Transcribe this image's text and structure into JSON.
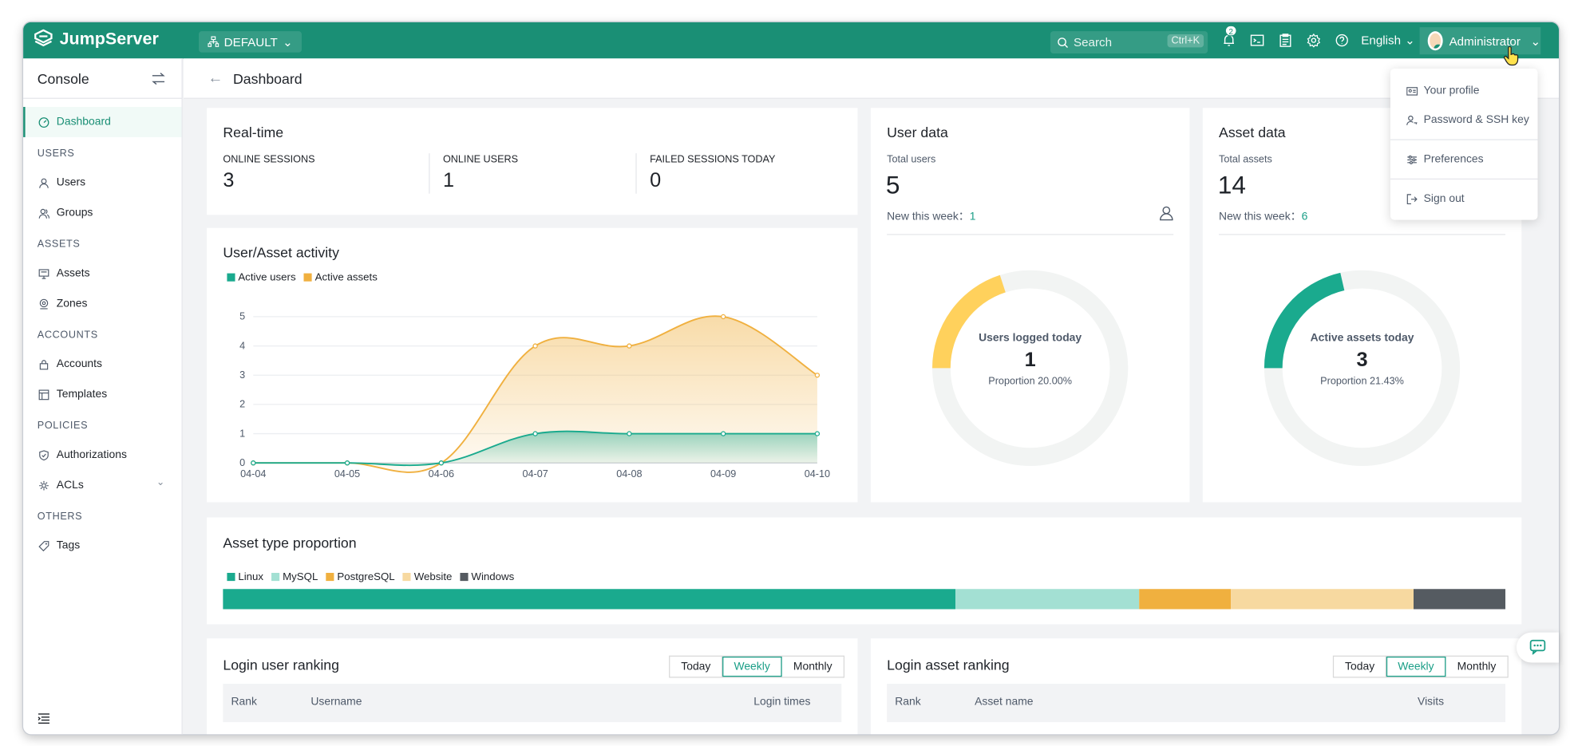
{
  "app": {
    "name": "JumpServer",
    "org": "DEFAULT"
  },
  "topbar": {
    "search_placeholder": "Search",
    "search_shortcut": "Ctrl+K",
    "notifications_count": "2",
    "language": "English",
    "user_name": "Administrator"
  },
  "sidebar": {
    "title": "Console",
    "dashboard": "Dashboard",
    "groups": [
      {
        "label": "USERS",
        "items": [
          "Users",
          "Groups"
        ]
      },
      {
        "label": "ASSETS",
        "items": [
          "Assets",
          "Zones"
        ]
      },
      {
        "label": "ACCOUNTS",
        "items": [
          "Accounts",
          "Templates"
        ]
      },
      {
        "label": "POLICIES",
        "items": [
          "Authorizations",
          "ACLs"
        ]
      },
      {
        "label": "OTHERS",
        "items": [
          "Tags"
        ]
      }
    ]
  },
  "page": {
    "title": "Dashboard"
  },
  "realtime": {
    "title": "Real-time",
    "online_sessions_label": "ONLINE SESSIONS",
    "online_sessions": "3",
    "online_users_label": "ONLINE USERS",
    "online_users": "1",
    "failed_sessions_label": "FAILED SESSIONS TODAY",
    "failed_sessions": "0"
  },
  "activity": {
    "title": "User/Asset activity",
    "legend_users": "Active users",
    "legend_assets": "Active assets",
    "color_users": "#1aaa8e",
    "color_assets": "#f0b03f"
  },
  "chart_data": {
    "type": "area",
    "title": "User/Asset activity",
    "x": [
      "04-04",
      "04-05",
      "04-06",
      "04-07",
      "04-08",
      "04-09",
      "04-10"
    ],
    "series": [
      {
        "name": "Active users",
        "values": [
          0,
          0,
          0,
          1,
          1,
          1,
          1
        ]
      },
      {
        "name": "Active assets",
        "values": [
          0,
          0,
          0,
          4,
          4,
          5,
          3
        ]
      }
    ],
    "yticks": [
      "0",
      "1",
      "2",
      "3",
      "4",
      "5"
    ],
    "ylim": [
      0,
      5
    ],
    "legend": "top-left",
    "grid": true
  },
  "user_data": {
    "title": "User data",
    "total_label": "Total users",
    "total": "5",
    "new_label": "New this week：",
    "new": "1",
    "donut_label": "Users logged today",
    "donut_value": "1",
    "proportion_label": "Proportion 20.00%",
    "fraction": 0.2,
    "color": "#ffd15c"
  },
  "asset_data": {
    "title": "Asset data",
    "total_label": "Total assets",
    "total": "14",
    "new_label": "New this week：",
    "new": "6",
    "donut_label": "Active assets today",
    "donut_value": "3",
    "proportion_label": "Proportion 21.43%",
    "fraction": 0.2143,
    "color": "#1aaa8e"
  },
  "asset_type": {
    "title": "Asset type proportion",
    "items": [
      {
        "name": "Linux",
        "value": 8,
        "color": "#1aaa8e"
      },
      {
        "name": "MySQL",
        "value": 2,
        "color": "#a3e0d3"
      },
      {
        "name": "PostgreSQL",
        "value": 1,
        "color": "#f0b03f"
      },
      {
        "name": "Website",
        "value": 2,
        "color": "#f7d9a0"
      },
      {
        "name": "Windows",
        "value": 1,
        "color": "#555b61"
      }
    ]
  },
  "login_user_ranking": {
    "title": "Login user ranking",
    "tabs": [
      "Today",
      "Weekly",
      "Monthly"
    ],
    "selected": "Weekly",
    "col_rank": "Rank",
    "col_name": "Username",
    "col_count": "Login times"
  },
  "login_asset_ranking": {
    "title": "Login asset ranking",
    "tabs": [
      "Today",
      "Weekly",
      "Monthly"
    ],
    "selected": "Weekly",
    "col_rank": "Rank",
    "col_name": "Asset name",
    "col_count": "Visits"
  },
  "user_menu": {
    "profile": "Your profile",
    "password": "Password & SSH key",
    "preferences": "Preferences",
    "signout": "Sign out"
  }
}
